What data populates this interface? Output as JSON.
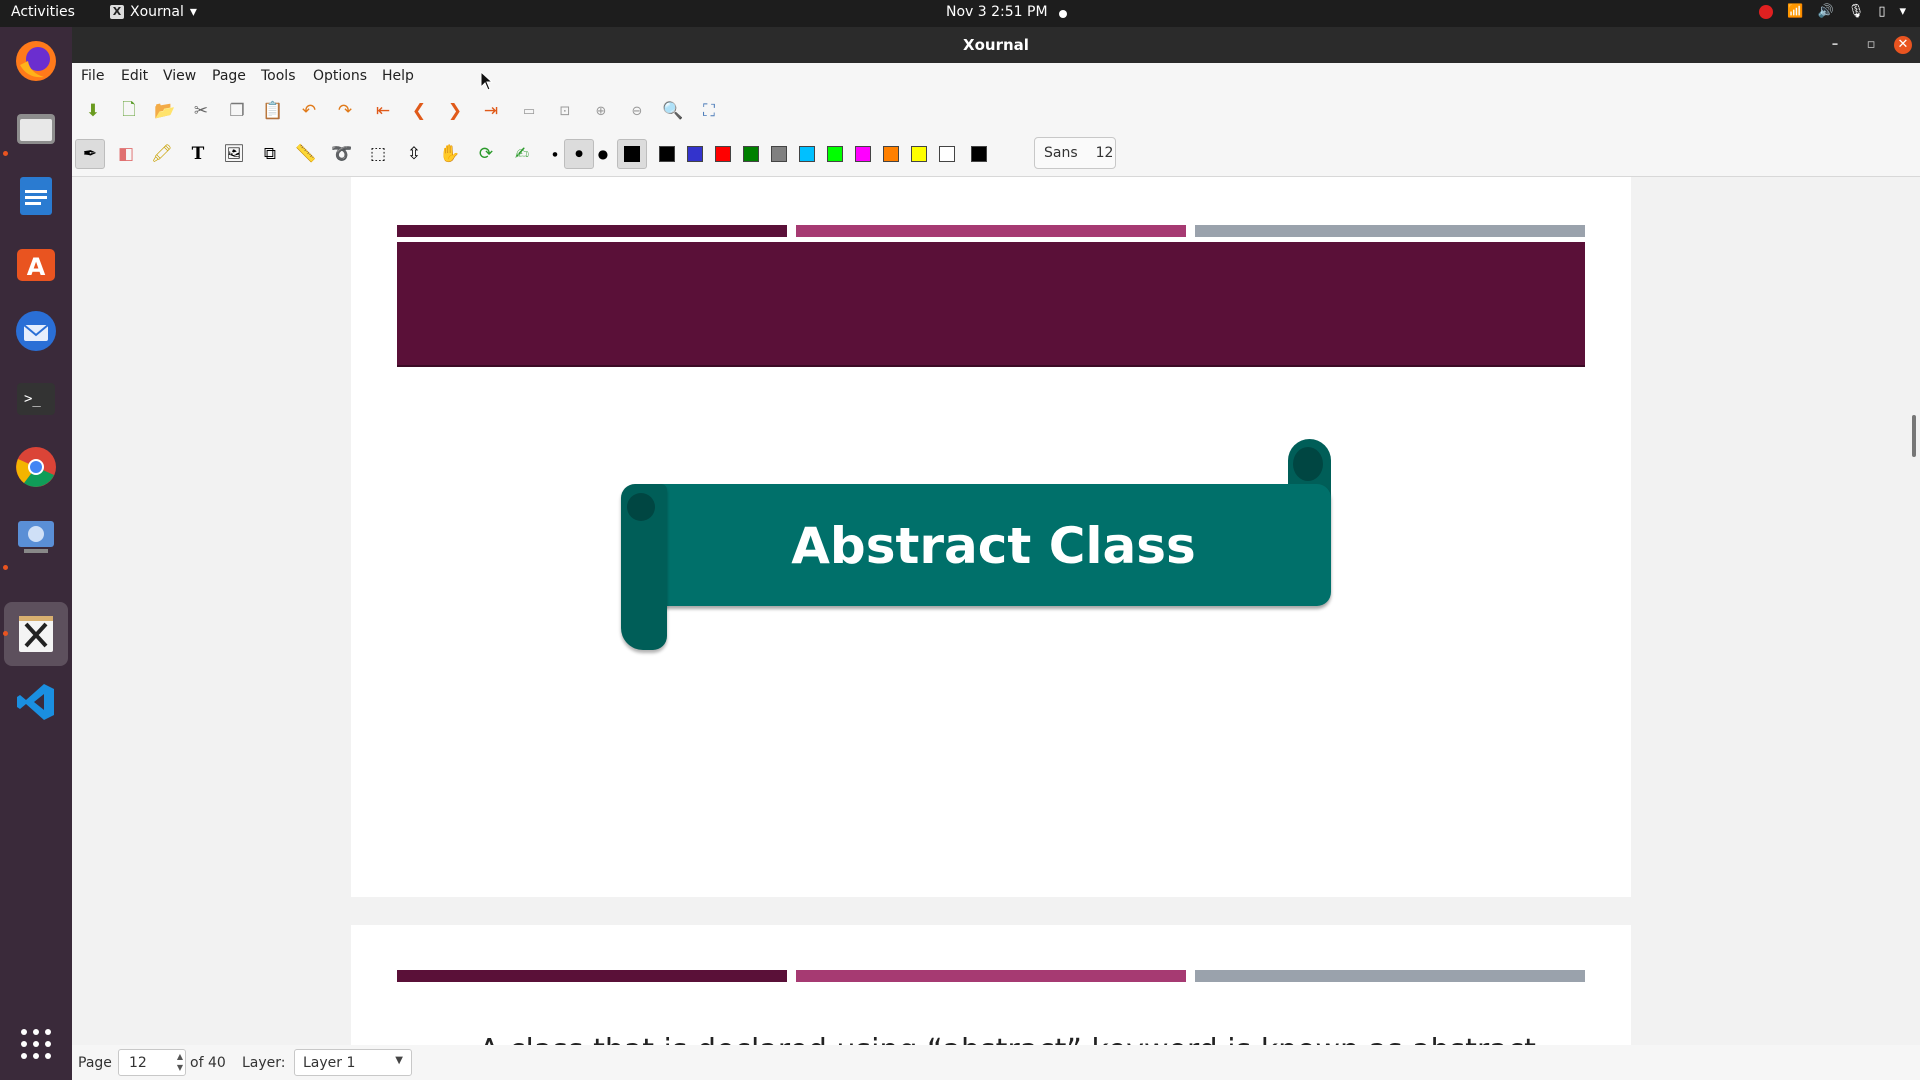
{
  "topbar": {
    "activities": "Activities",
    "app_name": "Xournal",
    "app_menu_arrow": "▾",
    "clock": "Nov 3  2:51 PM",
    "tray_icons": [
      "record-icon",
      "wifi-icon",
      "volume-icon",
      "mic-icon",
      "battery-icon",
      "system-menu-icon"
    ]
  },
  "dock": {
    "items": [
      "firefox",
      "files",
      "libreoffice-writer",
      "ubuntu-software",
      "thunderbird",
      "terminal",
      "chrome",
      "screenshot-tool",
      "xournal",
      "vscode"
    ],
    "show_apps_icon": "grid-icon"
  },
  "window": {
    "title": "Xournal",
    "minimize": "–",
    "maximize": "▫",
    "close": "✕"
  },
  "menu": {
    "file": "File",
    "edit": "Edit",
    "view": "View",
    "page": "Page",
    "tools": "Tools",
    "options": "Options",
    "help": "Help"
  },
  "toolbar_main": {
    "icons": [
      "save-icon",
      "new-icon",
      "open-icon",
      "cut-icon",
      "copy-icon",
      "paste-icon",
      "undo-icon",
      "redo-icon",
      "first-page-icon",
      "prev-page-icon",
      "next-page-icon",
      "last-page-icon",
      "zoom-width-icon",
      "zoom-fit-icon",
      "zoom-in-icon",
      "zoom-out-icon",
      "zoom-search-icon",
      "fullscreen-icon"
    ]
  },
  "toolbar_tools": {
    "icons": [
      "pen-icon",
      "eraser-icon",
      "highlighter-icon",
      "text-icon",
      "image-icon",
      "shape-recognizer-icon",
      "ruler-icon",
      "lasso-icon",
      "rect-select-icon",
      "vertical-space-icon",
      "hand-icon",
      "default-tool-icon",
      "default-pen-icon",
      "thin-dot-icon",
      "medium-dot-icon",
      "thick-dot-icon"
    ],
    "colors": [
      "#000000",
      "#3333cc",
      "#ff0000",
      "#008000",
      "#808080",
      "#00c0ff",
      "#00ff00",
      "#ff00ff",
      "#ff8000",
      "#ffff00",
      "#ffffff",
      "#000000"
    ],
    "font_name": "Sans",
    "font_size": "12"
  },
  "document": {
    "banner_text": "Abstract Class",
    "next_page_text": "A class that is declared using “abstract” keyword is known as abstract",
    "accent_colors": {
      "dark_band": "#5a1038",
      "pink_band": "#a63a72",
      "gray_band": "#9aa2ac",
      "teal": "#00706a"
    }
  },
  "status": {
    "page_label": "Page",
    "page_value": "12",
    "page_total": "of 40",
    "layer_label": "Layer:",
    "layer_value": "Layer 1"
  }
}
